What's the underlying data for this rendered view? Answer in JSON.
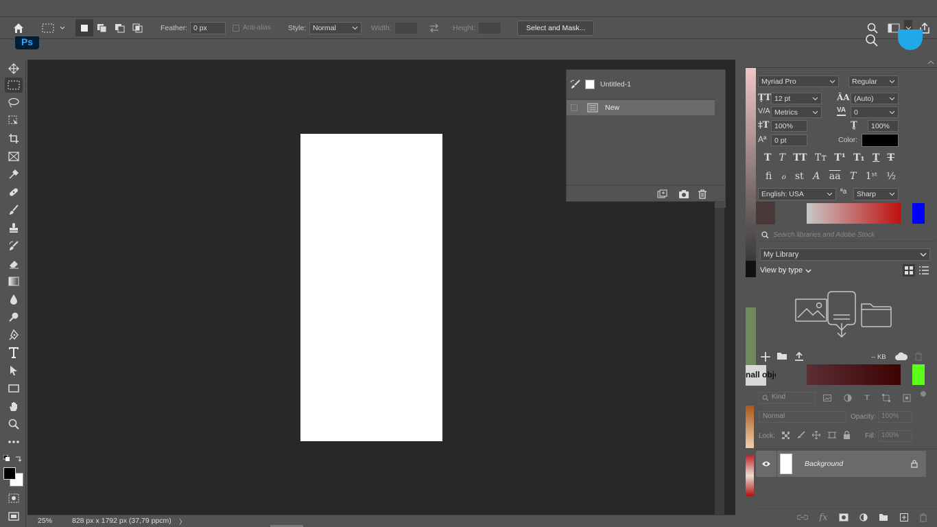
{
  "options_bar": {
    "feather_label": "Feather:",
    "feather_value": "0 px",
    "antialias_label": "Anti-alias",
    "style_label": "Style:",
    "style_value": "Normal",
    "width_label": "Width:",
    "height_label": "Height:",
    "select_mask_label": "Select and Mask..."
  },
  "app": {
    "logo": "Ps"
  },
  "history": {
    "snapshot_label": "Untitled-1",
    "state_label": "New"
  },
  "status": {
    "zoom": "25%",
    "doc_info": "828 px x 1792 px (37,79 ppcm)",
    "arrow": "〉"
  },
  "character": {
    "font_family": "Myriad Pro",
    "font_style": "Regular",
    "font_size": "12 pt",
    "leading": "(Auto)",
    "kerning": "Metrics",
    "tracking": "0",
    "vscale": "100%",
    "hscale": "100%",
    "baseline": "0 pt",
    "color_label": "Color:",
    "language": "English: USA",
    "antialias": "Sharp",
    "color_value": "#000000"
  },
  "libraries": {
    "search_placeholder": "Search libraries and Adobe Stock",
    "library_name": "My Library",
    "view_by": "View by type",
    "kb": "-- KB"
  },
  "behind_label": "nall obje",
  "layers": {
    "kind_label": "Kind",
    "blend_mode": "Normal",
    "opacity_label": "Opacity:",
    "opacity_value": "100%",
    "lock_label": "Lock:",
    "fill_label": "Fill:",
    "fill_value": "100%",
    "background_layer": "Background"
  },
  "colors": {
    "accent_blue": "#0000ff",
    "accent_green": "#5cff1a",
    "dark_red": "#5a0000",
    "ps_blue": "#31a8ff"
  }
}
